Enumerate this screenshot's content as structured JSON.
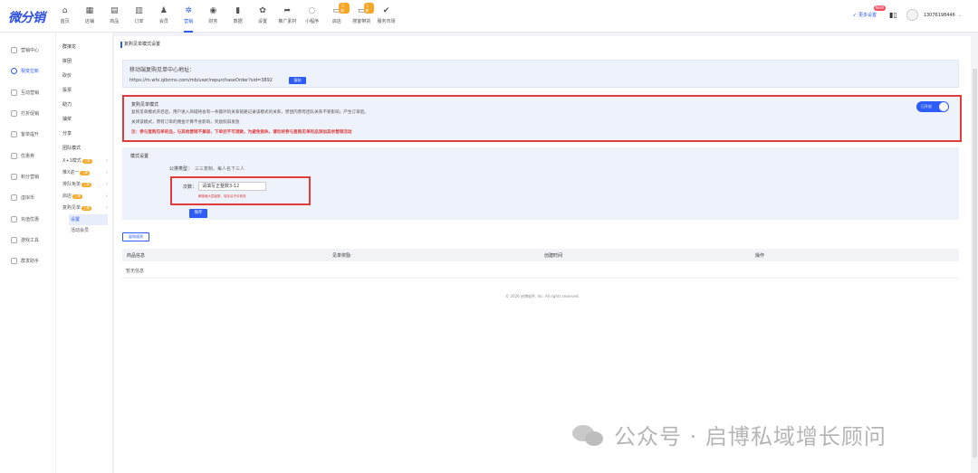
{
  "app": {
    "logo": "微分销"
  },
  "nav": [
    {
      "label": "首页",
      "icon": "home-icon",
      "glyph": "⌂"
    },
    {
      "label": "店铺",
      "icon": "shop-icon",
      "glyph": "▦"
    },
    {
      "label": "商品",
      "icon": "goods-icon",
      "glyph": "▤"
    },
    {
      "label": "订单",
      "icon": "order-icon",
      "glyph": "▥"
    },
    {
      "label": "会员",
      "icon": "member-icon",
      "glyph": "♟"
    },
    {
      "label": "营销",
      "icon": "marketing-icon",
      "glyph": "✲",
      "active": true
    },
    {
      "label": "财务",
      "icon": "finance-icon",
      "glyph": "◉"
    },
    {
      "label": "数据",
      "icon": "data-icon",
      "glyph": "▮"
    },
    {
      "label": "设置",
      "icon": "settings-icon",
      "glyph": "✿"
    },
    {
      "label": "推广素材",
      "icon": "share-icon",
      "glyph": "➦"
    },
    {
      "label": "小程序",
      "icon": "miniapp-icon",
      "glyph": "◌"
    },
    {
      "label": "启店",
      "icon": "store-icon",
      "glyph": "▭",
      "badge": "上新"
    },
    {
      "label": "搜客带货",
      "icon": "monitor-icon",
      "glyph": "▭",
      "badge": "上新"
    },
    {
      "label": "服务市场",
      "icon": "market-icon",
      "glyph": "✔"
    }
  ],
  "top_right": {
    "more_settings": "更多设置",
    "hot_badge": "NEW",
    "phone": "13076198446"
  },
  "sidebar1": [
    {
      "label": "营销中心"
    },
    {
      "label": "裂变拉新",
      "active": true
    },
    {
      "label": "互动营销"
    },
    {
      "label": "打折促销"
    },
    {
      "label": "客单提升"
    },
    {
      "label": "优惠券"
    },
    {
      "label": "积分营销"
    },
    {
      "label": "虚拟币"
    },
    {
      "label": "充值优惠"
    },
    {
      "label": "游戏工具"
    },
    {
      "label": "群发助手"
    }
  ],
  "sidebar2": {
    "items": [
      "群接龙",
      "拼团",
      "砍价",
      "投票",
      "助力",
      "抽奖",
      "分享",
      "团队模式"
    ],
    "subs": [
      {
        "label": "X+1模式",
        "tag": "上新"
      },
      {
        "label": "推X返一",
        "tag": "上新"
      },
      {
        "label": "排队免单",
        "tag": "上新"
      },
      {
        "label": "启店",
        "tag": "上新"
      },
      {
        "label": "复购见单",
        "tag": "上新"
      }
    ],
    "leaves": [
      {
        "label": "设置",
        "active": true
      },
      {
        "label": "活动会员"
      }
    ]
  },
  "page": {
    "title": "复购见单模式设置",
    "url_label": "移动端复购见单中心地址：",
    "url": "https://m.wfx.qibcms.com/mb/user/repurchaseOrder?sid=3892",
    "copy": "复制",
    "mode_title": "复购见单模式",
    "mode_desc_1": "复购见单模式开启后，用户进入商城将会有一条额外的关系链路记录该模式的关系，原团内原有团队关系不受影响，产生订单后。",
    "mode_desc_2": "关闭该模式，原有订单的佣金计算不会影响，奖励照旧发放",
    "mode_note": "注：参与复购见单的品，与其他营销不兼容，下单后不可退款，为避免损失，请勿将参与复购见单的品添加其余营销活动",
    "toggle_label": "已开启",
    "setting_title": "模式设置",
    "group_label": "公排类型：",
    "group_value": "三三复制、每人名下三人",
    "times_label": "次数：",
    "times_placeholder": "请填写正整数3-12",
    "times_hint": "解锁最大层级数，保存后不可修改",
    "save": "保存",
    "rule_btn": "复购规则",
    "table_headers": [
      "商品信息",
      "见单奖励",
      "创建时间",
      "操作"
    ],
    "empty": "暂无信息",
    "footer": "© 2026 启博软件, Inc. All rights reserved."
  },
  "watermark": "公众号 · 启博私域增长顾问"
}
